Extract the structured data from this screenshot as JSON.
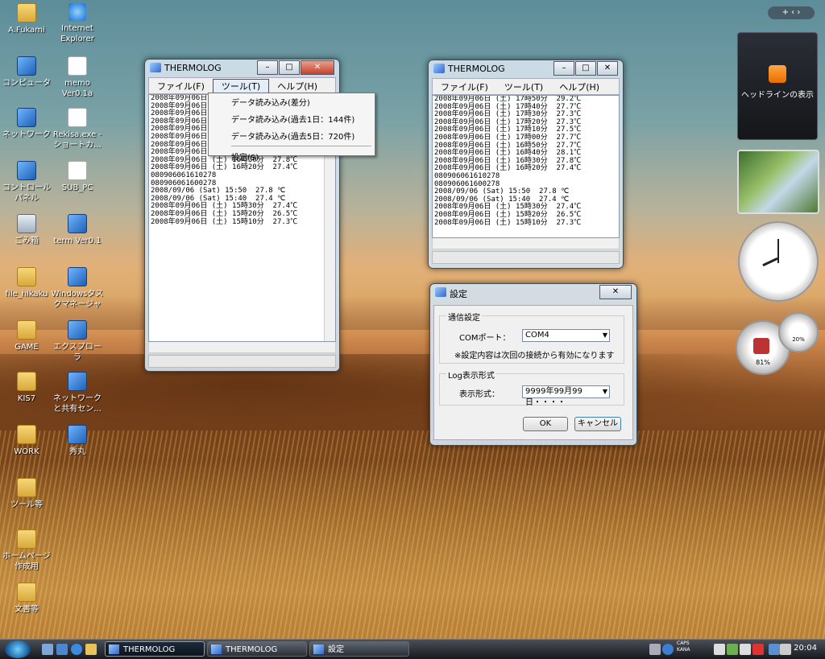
{
  "desktop": {
    "icons": [
      {
        "label": "A.Fukami",
        "type": "folder"
      },
      {
        "label": "Internet Explorer",
        "type": "ie"
      },
      {
        "label": "コンピュータ",
        "type": "computer"
      },
      {
        "label": "memo Ver0.1a",
        "type": "file"
      },
      {
        "label": "ネットワーク",
        "type": "network"
      },
      {
        "label": "Rekisa.exe - ショートカ...",
        "type": "shortcut"
      },
      {
        "label": "コントロール パネル",
        "type": "control-panel"
      },
      {
        "label": "SUB_PC",
        "type": "shortcut"
      },
      {
        "label": "ごみ箱",
        "type": "recycle-bin"
      },
      {
        "label": "term Ver0.1",
        "type": "app"
      },
      {
        "label": "file_hikaku",
        "type": "folder"
      },
      {
        "label": "Windowsタスクマネージャ",
        "type": "app"
      },
      {
        "label": "GAME",
        "type": "folder"
      },
      {
        "label": "エクスプローラ",
        "type": "app"
      },
      {
        "label": "KIS7",
        "type": "folder"
      },
      {
        "label": "ネットワークと共有セン...",
        "type": "app"
      },
      {
        "label": "WORK",
        "type": "folder"
      },
      {
        "label": "秀丸",
        "type": "app"
      },
      {
        "label": "ツール等",
        "type": "folder"
      },
      {
        "label": "ホームページ作成用",
        "type": "folder"
      },
      {
        "label": "文書等",
        "type": "folder"
      }
    ]
  },
  "win1": {
    "title": "THERMOLOG",
    "menus": [
      "ファイル(F)",
      "ツール(T)",
      "ヘルプ(H)"
    ],
    "dropdown": {
      "items": [
        "データ読み込み(差分)",
        "データ読み込み(過去1日：144件)",
        "データ読み込み(過去5日：720件)"
      ],
      "settings": "設定(S)"
    },
    "lines": [
      "2008年09月06日",
      "2008年09月06日",
      "2008年09月06日",
      "2008年09月06日",
      "2008年09月06日",
      "2008年09月06日",
      "2008年09月06日",
      "2008年09月06日 (土) 16時40分",
      "2008年09月06日 (土) 16時30分  27.8℃",
      "2008年09月06日 (土) 16時20分  27.4℃",
      "080906061610278",
      "080906061600278",
      "2008/09/06 (Sat) 15:50  27.8 ℃",
      "2008/09/06 (Sat) 15:40  27.4 ℃",
      "2008年09月06日 (土) 15時30分  27.4℃",
      "2008年09月06日 (土) 15時20分  26.5℃",
      "2008年09月06日 (土) 15時10分  27.3℃"
    ]
  },
  "win2": {
    "title": "THERMOLOG",
    "menus": [
      "ファイル(F)",
      "ツール(T)",
      "ヘルプ(H)"
    ],
    "lines": [
      "2008年09月06日 (土) 17時50分  29.2℃",
      "2008年09月06日 (土) 17時40分  27.7℃",
      "2008年09月06日 (土) 17時30分  27.3℃",
      "2008年09月06日 (土) 17時20分  27.3℃",
      "2008年09月06日 (土) 17時10分  27.5℃",
      "2008年09月06日 (土) 17時00分  27.7℃",
      "2008年09月06日 (土) 16時50分  27.7℃",
      "2008年09月06日 (土) 16時40分  28.1℃",
      "2008年09月06日 (土) 16時30分  27.8℃",
      "2008年09月06日 (土) 16時20分  27.4℃",
      "080906061610278",
      "080906061600278",
      "2008/09/06 (Sat) 15:50  27.8 ℃",
      "2008/09/06 (Sat) 15:40  27.4 ℃",
      "2008年09月06日 (土) 15時30分  27.4℃",
      "2008年09月06日 (土) 15時20分  26.5℃",
      "2008年09月06日 (土) 15時10分  27.3℃"
    ]
  },
  "settings": {
    "title": "設定",
    "comm_group": "通信設定",
    "com_label": "COMポート：",
    "com_value": "COM4",
    "note": "※設定内容は次回の接続から有効になります",
    "log_group": "Log表示形式",
    "format_label": "表示形式：",
    "format_value": "9999年99月99日・・・・",
    "ok": "OK",
    "cancel": "キャンセル"
  },
  "sidebar": {
    "headline": "ヘッドラインの表示",
    "cpu_label": "81%",
    "mem_label": "20%"
  },
  "taskbar": {
    "buttons": [
      "THERMOLOG",
      "THERMOLOG",
      "設定"
    ],
    "tray": {
      "caps": "CAPS",
      "kana": "KANA"
    },
    "clock": "20:04"
  }
}
